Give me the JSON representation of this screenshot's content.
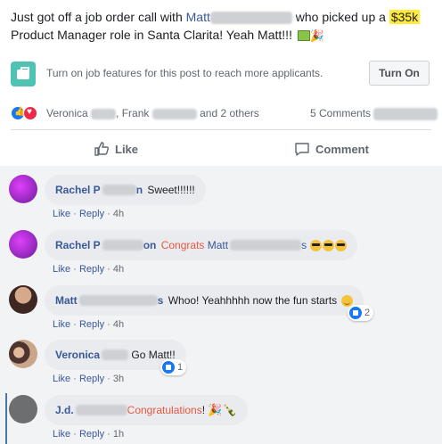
{
  "post": {
    "text_before": "Just got off a job order call with ",
    "name_first": "Matt",
    "text_after_name": " who picked up a ",
    "salary": "$35k",
    "text_line2": " Product Manager role in Santa Clarita! Yeah Matt!!! ",
    "party_emoji": "🎉"
  },
  "job_bar": {
    "icon": "briefcase-icon",
    "prompt": "Turn on job features for this post to reach more applicants.",
    "button_label": "Turn On"
  },
  "reactions": {
    "reactors_part1": "Veronica",
    "reactors_part2": "Frank",
    "reactors_part3": "and 2 others",
    "comments": "5 Comments"
  },
  "actions": {
    "like_label": "Like",
    "comment_label": "Comment"
  },
  "comments": [
    {
      "name": "Rachel P",
      "name_tail": "n",
      "text": "Sweet!!!!!!",
      "like": "Like",
      "reply": "Reply",
      "time": "4h"
    },
    {
      "name": "Rachel P",
      "name_tail": "on",
      "highlight": "Congrats",
      "mention": "Matt",
      "mention_tail": "s",
      "like": "Like",
      "reply": "Reply",
      "time": "4h"
    },
    {
      "name": "Matt",
      "name_tail": "s",
      "text": "Whoo! Yeahhhhh now the fun starts",
      "like": "Like",
      "reply": "Reply",
      "time": "4h",
      "reaction_count": "2"
    },
    {
      "name": "Veronica",
      "text": "Go Matt!!",
      "like": "Like",
      "reply": "Reply",
      "time": "3h",
      "reaction_count": "1"
    },
    {
      "name": "J.d.",
      "highlight": "Congratulations",
      "text_tail": "!",
      "like": "Like",
      "reply": "Reply",
      "time": "1h"
    }
  ],
  "colors": {
    "link": "#385898",
    "highlight": "#ffeb3b",
    "congrats": "#e9573f",
    "like_blue": "#1877f2"
  }
}
